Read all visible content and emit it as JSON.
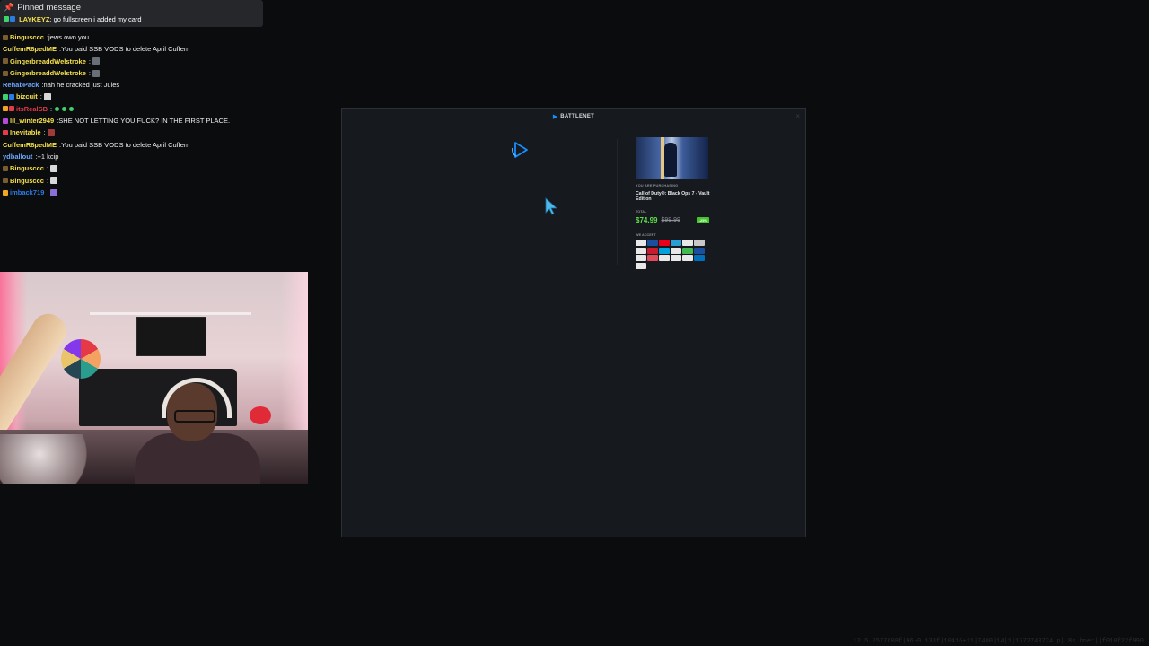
{
  "pinned": {
    "header": "Pinned message",
    "user": "LAYKEYZ",
    "user_color": "#f4e04d",
    "text": "go fullscreen i added my card"
  },
  "chat": [
    {
      "user": "Bingusccc",
      "color": "#f4e04d",
      "text": "jews own you",
      "badges": [
        "#7a5c2e"
      ],
      "emote": ""
    },
    {
      "user": "CuffemR8pedME",
      "color": "#f4e04d",
      "text": "You paid SSB VODS to delete April Cuffem",
      "badges": [],
      "emote": ""
    },
    {
      "user": "GingerbreaddWelstroke",
      "color": "#f4e04d",
      "text": "",
      "badges": [
        "#7a5c2e"
      ],
      "emote": "#6a6f77"
    },
    {
      "user": "GingerbreaddWelstroke",
      "color": "#f4e04d",
      "text": "",
      "badges": [
        "#7a5c2e"
      ],
      "emote": "#6a6f77"
    },
    {
      "user": "RehabPack",
      "color": "#6ea9ff",
      "text": "nah he cracked just Jules",
      "badges": [],
      "emote": ""
    },
    {
      "user": "bizcuit",
      "color": "#f4e04d",
      "text": "",
      "badges": [
        "#3fd16a",
        "#2b7be4"
      ],
      "emote": "#d8d8d8"
    },
    {
      "user": "itsRealSB",
      "color": "#e53a4a",
      "text": "",
      "badges": [
        "#f4a623",
        "#e53a4a"
      ],
      "emote_round": true
    },
    {
      "user": "lil_winter2949",
      "color": "#f4e04d",
      "text": "SHE NOT LETTING YOU FUCK? IN THE FIRST PLACE.",
      "badges": [
        "#b44bd6"
      ],
      "emote": ""
    },
    {
      "user": "Inevitable",
      "color": "#f4e04d",
      "text": "",
      "badges": [
        "#e53a4a"
      ],
      "emote": "#9e3a3a"
    },
    {
      "user": "CuffemR8pedME",
      "color": "#f4e04d",
      "text": "You paid SSB VODS to delete April Cuffem",
      "badges": [],
      "emote": ""
    },
    {
      "user": "ydballout",
      "color": "#6ea9ff",
      "text": "+1 kcip",
      "badges": [],
      "emote": ""
    },
    {
      "user": "Bingusccc",
      "color": "#f4e04d",
      "text": "",
      "badges": [
        "#7a5c2e"
      ],
      "emote": "#d8d8d8"
    },
    {
      "user": "Bingusccc",
      "color": "#f4e04d",
      "text": "",
      "badges": [
        "#7a5c2e"
      ],
      "emote": "#d8d8d8"
    },
    {
      "user": "imback719",
      "color": "#2b7be4",
      "text": "",
      "badges": [
        "#f4a623"
      ],
      "emote": "#8b6fd6"
    }
  ],
  "battlenet": {
    "title": "BATTLENET",
    "close_icon": "×",
    "purchasing_label": "YOU ARE PURCHASING",
    "product": "Call of Duty®: Black Ops 7 - Vault Edition",
    "total_label": "TOTAL",
    "price": "$74.99",
    "original_price": "$99.99",
    "discount": "-25%",
    "accept_label": "WE ACCEPT",
    "payment_colors": [
      "#e8e8e8",
      "#1a4fa0",
      "#eb001b",
      "#2a9fd6",
      "#e8e8e8",
      "#c8c8c8",
      "#e8e8e8",
      "#c81c2e",
      "#00a3e0",
      "#e8e8e8",
      "#3fb950",
      "#1a4fa0",
      "#e8e8e8",
      "#e04b5a",
      "#e8e8e8",
      "#e8e8e8",
      "#e8e8e8",
      "#0070ba",
      "#e8e8e8"
    ]
  },
  "colors": {
    "accent": "#148eff",
    "price": "#5ee04a",
    "discount_bg": "#43c52e"
  },
  "debug_text": "12.5.2577608f|96-0.133f|10416+11|7400|14|1|1772743724.p|.8s.bnet||f010f22f990"
}
